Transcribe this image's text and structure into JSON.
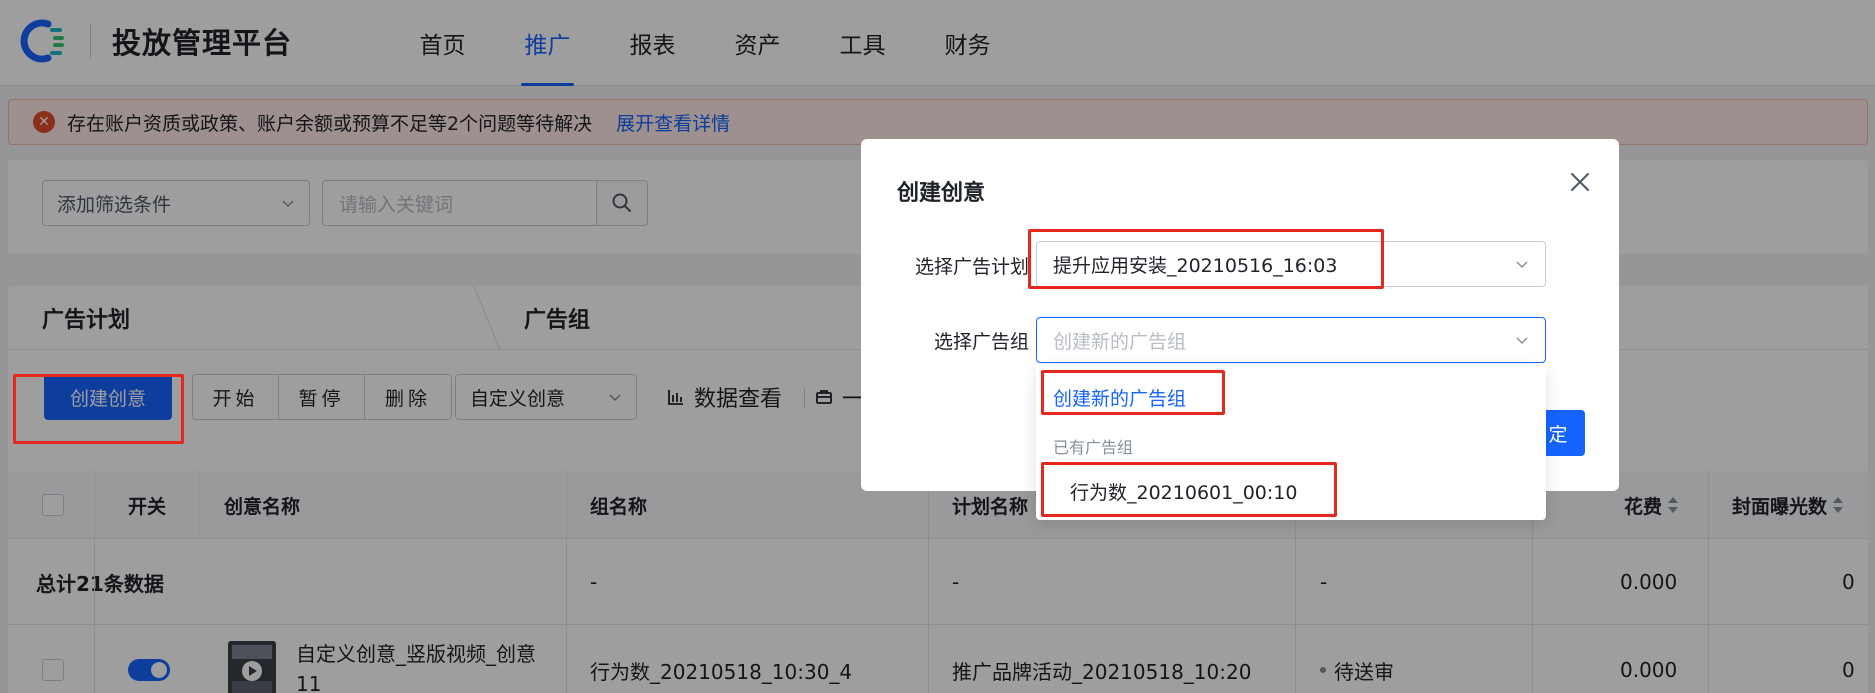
{
  "app": {
    "title": "投放管理平台"
  },
  "nav": [
    {
      "label": "首页",
      "active": false
    },
    {
      "label": "推广",
      "active": true
    },
    {
      "label": "报表",
      "active": false
    },
    {
      "label": "资产",
      "active": false
    },
    {
      "label": "工具",
      "active": false
    },
    {
      "label": "财务",
      "active": false
    }
  ],
  "alert": {
    "text": "存在账户资质或政策、账户余额或预算不足等2个问题等待解决",
    "link": "展开查看详情"
  },
  "filters": {
    "add_filter": "添加筛选条件",
    "keyword_placeholder": "请输入关键词"
  },
  "level_tabs": [
    "广告计划",
    "广告组"
  ],
  "toolbar": {
    "create": "创建创意",
    "start": "开始",
    "pause": "暂停",
    "delete": "删除",
    "custom_creative": "自定义创意",
    "data_view": "数据查看",
    "more": "一"
  },
  "table": {
    "headers": {
      "switch": "开关",
      "creative_name": "创意名称",
      "group_name": "组名称",
      "plan_name": "计划名称",
      "cost": "花费",
      "cover_impressions": "封面曝光数"
    },
    "summary": {
      "label": "总计21条数据",
      "group": "-",
      "plan": "-",
      "status": "-",
      "cost": "0.000",
      "impressions": "0"
    },
    "rows": [
      {
        "creative_name": "自定义创意_竖版视频_创意11",
        "group_name": "行为数_20210518_10:30_4",
        "plan_name": "推广品牌活动_20210518_10:20",
        "status": "待送审",
        "cost": "0.000",
        "impressions": "0"
      }
    ]
  },
  "modal": {
    "title": "创建创意",
    "plan_label": "选择广告计划",
    "plan_value": "提升应用安装_20210516_16:03",
    "group_label": "选择广告组",
    "group_placeholder": "创建新的广告组",
    "confirm_partial": "定"
  },
  "dropdown": {
    "new_item": "创建新的广告组",
    "group_title": "已有广告组",
    "items": [
      "行为数_20210601_00:10"
    ]
  },
  "colors": {
    "primary": "#1664ff",
    "highlight": "#e4281e",
    "alert_bg": "#fde9e6"
  }
}
